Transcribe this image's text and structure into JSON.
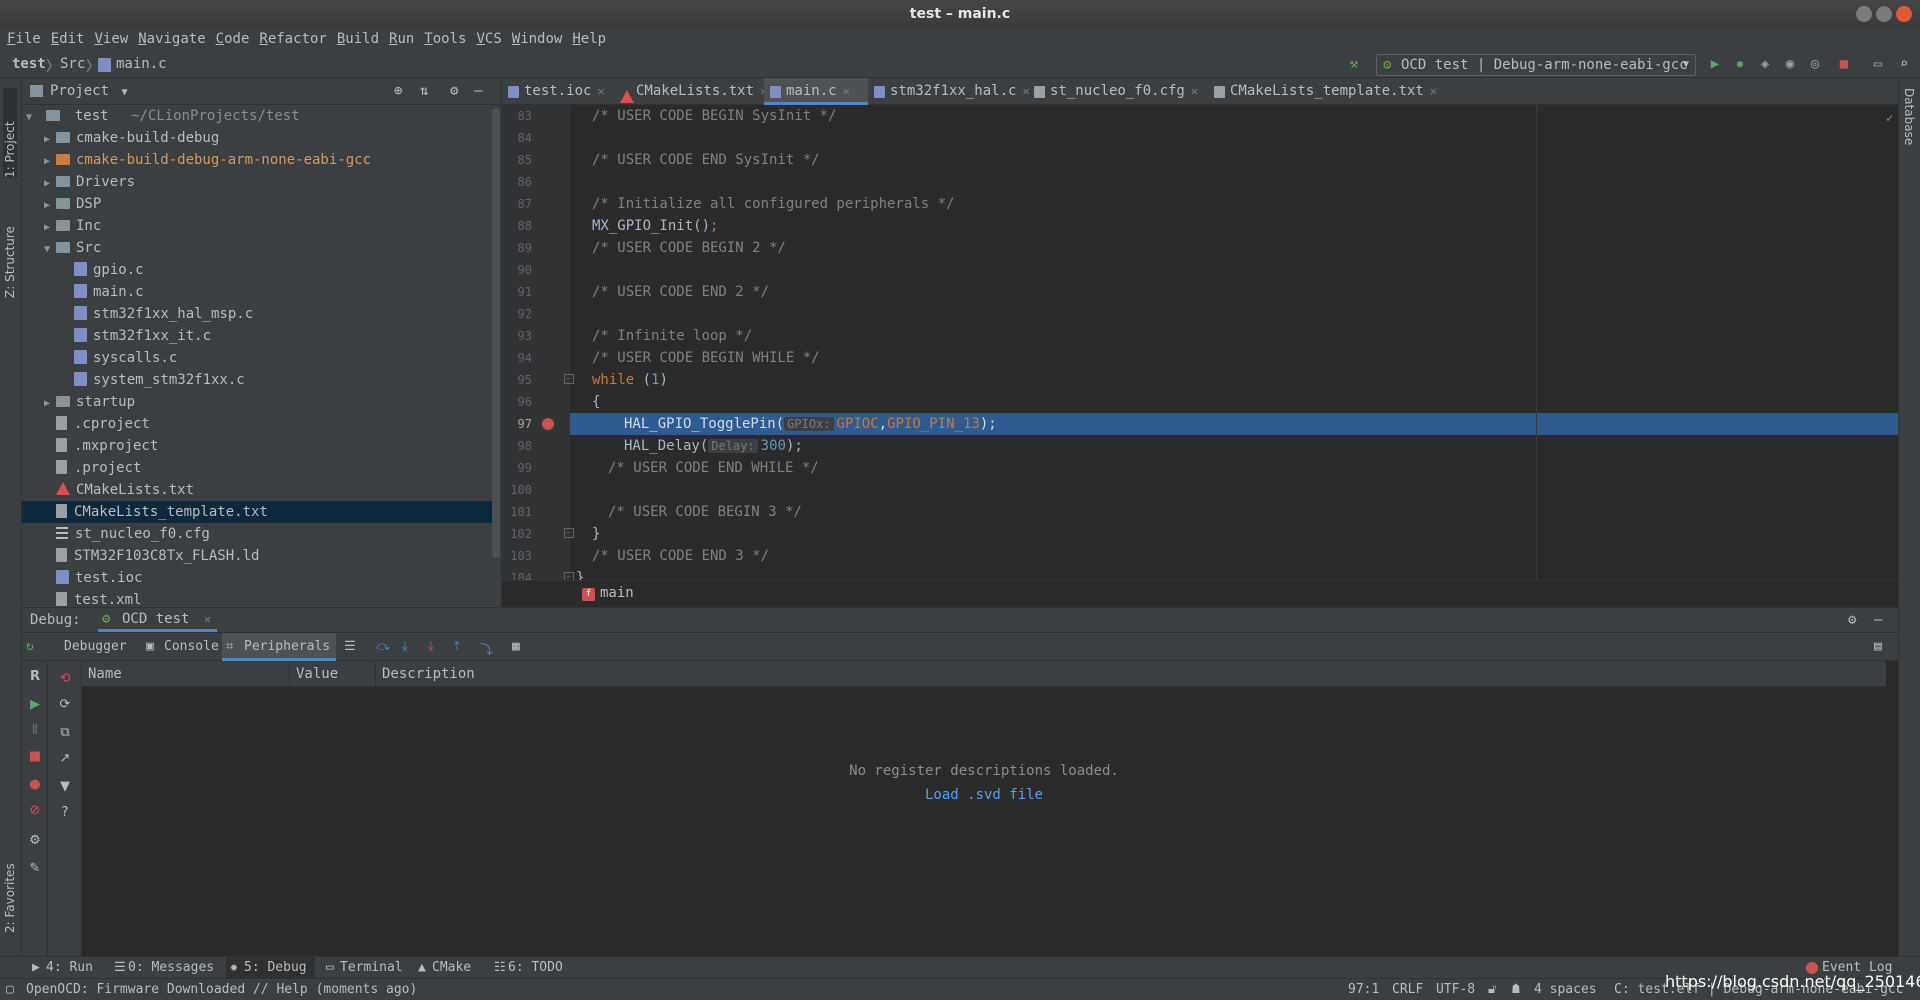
{
  "window": {
    "title": "test – main.c"
  },
  "menu": [
    "File",
    "Edit",
    "View",
    "Navigate",
    "Code",
    "Refactor",
    "Build",
    "Run",
    "Tools",
    "VCS",
    "Window",
    "Help"
  ],
  "breadcrumbs": [
    "test",
    "Src",
    "main.c"
  ],
  "run_config": "OCD test | Debug-arm-none-eabi-gcc",
  "side_tabs": {
    "project": "1: Project",
    "structure": "Z: Structure",
    "favorites": "2: Favorites",
    "database": "Database"
  },
  "project_panel": {
    "title": "Project",
    "root": {
      "name": "test",
      "path": "~/CLionProjects/test"
    },
    "items": [
      {
        "name": "cmake-build-debug",
        "kind": "folder",
        "expanded": false,
        "depth": 1
      },
      {
        "name": "cmake-build-debug-arm-none-eabi-gcc",
        "kind": "folder-orange",
        "expanded": false,
        "depth": 1
      },
      {
        "name": "Drivers",
        "kind": "folder",
        "expanded": false,
        "depth": 1
      },
      {
        "name": "DSP",
        "kind": "folder",
        "expanded": false,
        "depth": 1
      },
      {
        "name": "Inc",
        "kind": "folder",
        "expanded": false,
        "depth": 1
      },
      {
        "name": "Src",
        "kind": "folder",
        "expanded": true,
        "depth": 1
      },
      {
        "name": "gpio.c",
        "kind": "c",
        "depth": 2
      },
      {
        "name": "main.c",
        "kind": "c",
        "depth": 2
      },
      {
        "name": "stm32f1xx_hal_msp.c",
        "kind": "c",
        "depth": 2
      },
      {
        "name": "stm32f1xx_it.c",
        "kind": "c",
        "depth": 2
      },
      {
        "name": "syscalls.c",
        "kind": "c",
        "depth": 2
      },
      {
        "name": "system_stm32f1xx.c",
        "kind": "c",
        "depth": 2
      },
      {
        "name": "startup",
        "kind": "folder",
        "expanded": false,
        "depth": 1
      },
      {
        "name": ".cproject",
        "kind": "generic",
        "depth": 1
      },
      {
        "name": ".mxproject",
        "kind": "generic",
        "depth": 1
      },
      {
        "name": ".project",
        "kind": "generic",
        "depth": 1
      },
      {
        "name": "CMakeLists.txt",
        "kind": "cmake",
        "depth": 1
      },
      {
        "name": "CMakeLists_template.txt",
        "kind": "generic",
        "depth": 1,
        "selected": true
      },
      {
        "name": "st_nucleo_f0.cfg",
        "kind": "lines",
        "depth": 1
      },
      {
        "name": "STM32F103C8Tx_FLASH.ld",
        "kind": "generic",
        "depth": 1
      },
      {
        "name": "test.ioc",
        "kind": "c",
        "depth": 1
      },
      {
        "name": "test.xml",
        "kind": "generic",
        "depth": 1
      }
    ]
  },
  "editor_tabs": [
    {
      "label": "test.ioc"
    },
    {
      "label": "CMakeLists.txt"
    },
    {
      "label": "main.c",
      "active": true
    },
    {
      "label": "stm32f1xx_hal.c"
    },
    {
      "label": "st_nucleo_f0.cfg"
    },
    {
      "label": "CMakeLists_template.txt"
    }
  ],
  "editor": {
    "current_line": "97",
    "lines": [
      {
        "n": "83",
        "text": "/* USER CODE BEGIN SysInit */"
      },
      {
        "n": "84",
        "text": ""
      },
      {
        "n": "85",
        "text": "/* USER CODE END SysInit */"
      },
      {
        "n": "86",
        "text": ""
      },
      {
        "n": "87",
        "text": "/* Initialize all configured peripherals */"
      },
      {
        "n": "88",
        "text": "MX_GPIO_Init();"
      },
      {
        "n": "89",
        "text": "/* USER CODE BEGIN 2 */"
      },
      {
        "n": "90",
        "text": ""
      },
      {
        "n": "91",
        "text": "/* USER CODE END 2 */"
      },
      {
        "n": "92",
        "text": ""
      },
      {
        "n": "93",
        "text": "/* Infinite loop */"
      },
      {
        "n": "94",
        "text": "/* USER CODE BEGIN WHILE */"
      },
      {
        "n": "95",
        "text": "while (1)"
      },
      {
        "n": "96",
        "text": "{"
      },
      {
        "n": "97",
        "text": "HAL_GPIO_TogglePin(GPIOC,GPIO_PIN_13);",
        "hint": "GPIOx:"
      },
      {
        "n": "98",
        "text": "HAL_Delay(300);",
        "hint": "Delay:"
      },
      {
        "n": "99",
        "text": "/* USER CODE END WHILE */"
      },
      {
        "n": "100",
        "text": ""
      },
      {
        "n": "101",
        "text": "/* USER CODE BEGIN 3 */"
      },
      {
        "n": "102",
        "text": "}"
      },
      {
        "n": "103",
        "text": "/* USER CODE END 3 */"
      },
      {
        "n": "104",
        "text": "}"
      }
    ],
    "breadcrumb_fn": "main"
  },
  "debug": {
    "label": "Debug:",
    "session_tab": "OCD test",
    "tabs": [
      "Debugger",
      "Console",
      "Peripherals"
    ],
    "active_tab": "Peripherals",
    "columns": [
      "Name",
      "Value",
      "Description"
    ],
    "empty_message": "No register descriptions loaded.",
    "load_link": "Load .svd file"
  },
  "tool_stripe": [
    {
      "label": "4: Run"
    },
    {
      "label": "0: Messages"
    },
    {
      "label": "5: Debug",
      "active": true
    },
    {
      "label": "Terminal"
    },
    {
      "label": "CMake"
    },
    {
      "label": "6: TODO"
    }
  ],
  "event_log": "Event Log",
  "status": {
    "message": "OpenOCD: Firmware Downloaded // Help (moments ago)",
    "position": "97:1",
    "line_sep": "CRLF",
    "encoding": "UTF-8",
    "indent": "4 spaces",
    "context": "C: test.elf | Debug-arm-none-eabi-gcc"
  },
  "watermark": "https://blog.csdn.net/qq_25014669",
  "colors": {
    "accent": "#4a88c7",
    "selection": "#2d5b92",
    "keyword": "#cc7832",
    "comment": "#808080",
    "number": "#6897bb"
  }
}
